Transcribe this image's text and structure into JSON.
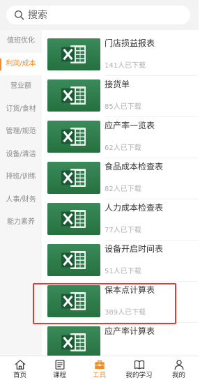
{
  "search": {
    "placeholder": "搜索",
    "icon": "search-icon"
  },
  "sidebar": {
    "items": [
      {
        "label": "值班优化"
      },
      {
        "label": "利润/成本",
        "selected": true
      },
      {
        "label": "营业额"
      },
      {
        "label": "订货/食材"
      },
      {
        "label": "管理/规范"
      },
      {
        "label": "设备/清洁"
      },
      {
        "label": "排班/训练"
      },
      {
        "label": "人事/财务"
      },
      {
        "label": "能力素养"
      }
    ]
  },
  "files": [
    {
      "title": "门店损益报表",
      "downloads": "141人已下载",
      "file_icon": "excel-file-icon"
    },
    {
      "title": "接货单",
      "downloads": "85人已下载",
      "file_icon": "excel-file-icon"
    },
    {
      "title": "应产率一览表",
      "downloads": "62人已下载",
      "file_icon": "excel-file-icon"
    },
    {
      "title": "食品成本检查表",
      "downloads": "82人已下载",
      "file_icon": "excel-file-icon"
    },
    {
      "title": "人力成本检查表",
      "downloads": "77人已下载",
      "file_icon": "excel-file-icon"
    },
    {
      "title": "设备开启时间表",
      "downloads": "51人已下载",
      "file_icon": "excel-file-icon"
    },
    {
      "title": "保本点计算表",
      "downloads": "389人已下载",
      "file_icon": "excel-file-icon",
      "highlighted": true
    },
    {
      "title": "应产率计算表",
      "file_icon": "excel-file-icon"
    }
  ],
  "tabbar": {
    "items": [
      {
        "label": "首页",
        "icon": "home-icon"
      },
      {
        "label": "课程",
        "icon": "course-icon"
      },
      {
        "label": "工具",
        "icon": "toolbox-icon",
        "selected": true
      },
      {
        "label": "我的学习",
        "icon": "book-icon"
      },
      {
        "label": "我的",
        "icon": "person-icon"
      }
    ]
  },
  "colors": {
    "accent": "#f08c2a",
    "highlight": "#e53935",
    "excel": "#2f7d4e",
    "sidebar_bg": "#f6f6f6"
  }
}
